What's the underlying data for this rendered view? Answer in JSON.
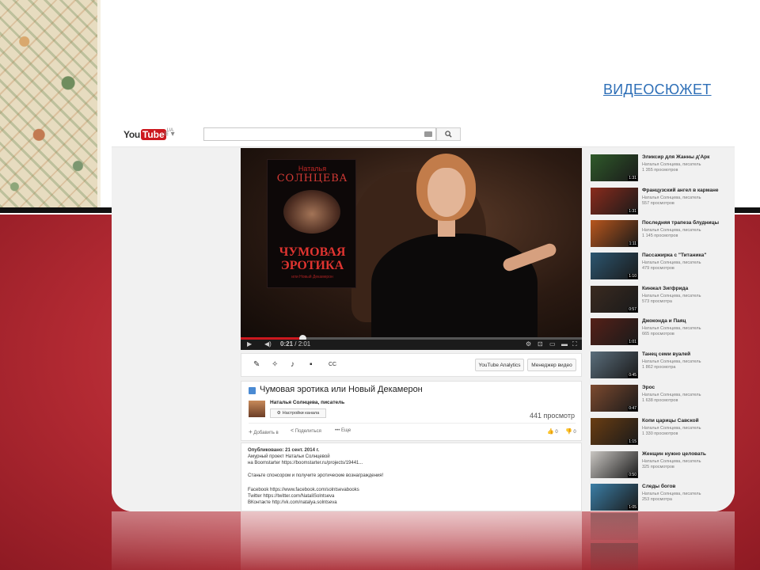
{
  "slide": {
    "link_text": "ВИДЕОСЮЖЕТ"
  },
  "youtube": {
    "logo_you": "You",
    "logo_tube": "Tube",
    "logo_region": "UA",
    "search_value": "",
    "search_icon": "search-icon"
  },
  "player": {
    "book_author": "Наталья",
    "book_surname": "СОЛНЦЕВА",
    "book_title_1": "ЧУМОВАЯ",
    "book_title_2": "ЭРОТИКА",
    "book_subtitle": "или Новый Декамерон",
    "progress_fraction": 0.18,
    "time_current": "0:21",
    "time_total": "2:01"
  },
  "toolbar": {
    "analytics_label": "YouTube Analytics",
    "manager_label": "Менеджер видео"
  },
  "video": {
    "title": "Чумовая эротика или Новый Декамерон",
    "channel_name": "Наталья Солнцева, писатель",
    "channel_settings": "Настройки канала",
    "views": "441 просмотр",
    "add_to": "Добавить в",
    "share": "Поделиться",
    "more": "Еще",
    "likes": "0",
    "dislikes": "0"
  },
  "description": {
    "published": "Опубликовано: 21 сент. 2014 г.",
    "lines": [
      "Амурный проект Натальи Солнцевой",
      "на Boomstarter https://boomstarter.ru/projects/19441...",
      "",
      "Станьте спонсором и получите эротические вознаграждения!",
      "",
      "Facebook https://www.facebook.com/solntsevabooks",
      "Twitter https://twitter.com/NataliSolntseva",
      "ВКонтакте http://vk.com/natalya.solntseva"
    ]
  },
  "related": [
    {
      "title": "Эликсир для Жанны д'Арк",
      "author": "Наталья Солнцева, писатель",
      "views": "1 355 просмотров",
      "duration": "1:31",
      "color": "#2f5a2a"
    },
    {
      "title": "Французский ангел в кармане",
      "author": "Наталья Солнцева, писатель",
      "views": "557 просмотров",
      "duration": "1:31",
      "color": "#8a2b1c"
    },
    {
      "title": "Последняя трапеза блудницы",
      "author": "Наталья Солнцева, писатель",
      "views": "1 145 просмотров",
      "duration": "1:11",
      "color": "#b8561c"
    },
    {
      "title": "Пассажирка с \"Титаника\"",
      "author": "Наталья Солнцева, писатель",
      "views": "479 просмотров",
      "duration": "1:10",
      "color": "#2c5670"
    },
    {
      "title": "Кинжал Зигфрида",
      "author": "Наталья Солнцева, писатель",
      "views": "573 просмотра",
      "duration": "0:57",
      "color": "#3a2a20"
    },
    {
      "title": "Джоконда и Паяц",
      "author": "Наталья Солнцева, писатель",
      "views": "665 просмотров",
      "duration": "1:01",
      "color": "#552018"
    },
    {
      "title": "Танец семи вуалей",
      "author": "Наталья Солнцева, писатель",
      "views": "1 862 просмотра",
      "duration": "0:45",
      "color": "#5b6e7c"
    },
    {
      "title": "Эрос",
      "author": "Наталья Солнцева, писатель",
      "views": "1 638 просмотров",
      "duration": "0:47",
      "color": "#7d4a2f"
    },
    {
      "title": "Копи царицы Савской",
      "author": "Наталья Солнцева, писатель",
      "views": "1 330 просмотров",
      "duration": "1:15",
      "color": "#6a3d12"
    },
    {
      "title": "Женщин нужно целовать",
      "author": "Наталья Солнцева, писатель",
      "views": "325 просмотров",
      "duration": "0:50",
      "color": "#c9c6c2"
    },
    {
      "title": "Следы богов",
      "author": "Наталья Солнцева, писатель",
      "views": "253 просмотра",
      "duration": "1:05",
      "color": "#3b7ea6"
    }
  ]
}
